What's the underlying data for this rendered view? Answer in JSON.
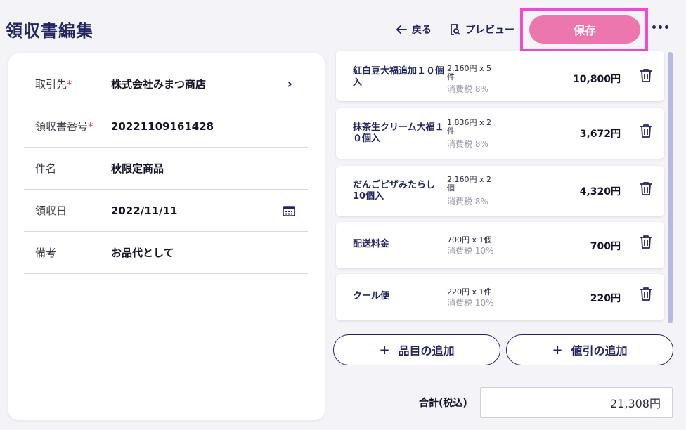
{
  "header": {
    "title": "領収書編集",
    "back_label": "戻る",
    "preview_label": "プレビュー",
    "save_label": "保存"
  },
  "form": {
    "rows": [
      {
        "label": "取引先",
        "required": true,
        "value": "株式会社みまつ商店"
      },
      {
        "label": "領収書番号",
        "required": true,
        "value": "20221109161428"
      },
      {
        "label": "件名",
        "required": false,
        "value": "秋限定商品"
      },
      {
        "label": "領収日",
        "required": false,
        "value": "2022/11/11"
      },
      {
        "label": "備考",
        "required": false,
        "value": "お品代として"
      }
    ],
    "required_mark": "*"
  },
  "items": [
    {
      "name": "紅白豆大福追加１０個入",
      "qty": "2,160円 x 5件",
      "tax": "消費税 8%",
      "amount": "10,800円"
    },
    {
      "name": "抹茶生クリーム大福１０個入",
      "qty": "1,836円 x 2件",
      "tax": "消費税 8%",
      "amount": "3,672円"
    },
    {
      "name": "だんごピザみたらし10個入",
      "qty": "2,160円 x 2個",
      "tax": "消費税 8%",
      "amount": "4,320円"
    },
    {
      "name": "配送料金",
      "qty": "700円 x 1個",
      "tax": "消費税 10%",
      "amount": "700円"
    },
    {
      "name": "クール便",
      "qty": "220円 x 1件",
      "tax": "消費税 10%",
      "amount": "220円"
    }
  ],
  "actions": {
    "add_item_label": "品目の追加",
    "add_discount_label": "値引の追加",
    "plus": "+"
  },
  "total": {
    "label": "合計(税込)",
    "value": "21,308円"
  },
  "colors": {
    "navy": "#232562",
    "save_pink": "#ec77ae",
    "highlight_magenta": "#f04bd0",
    "required_red": "#e0303a"
  }
}
